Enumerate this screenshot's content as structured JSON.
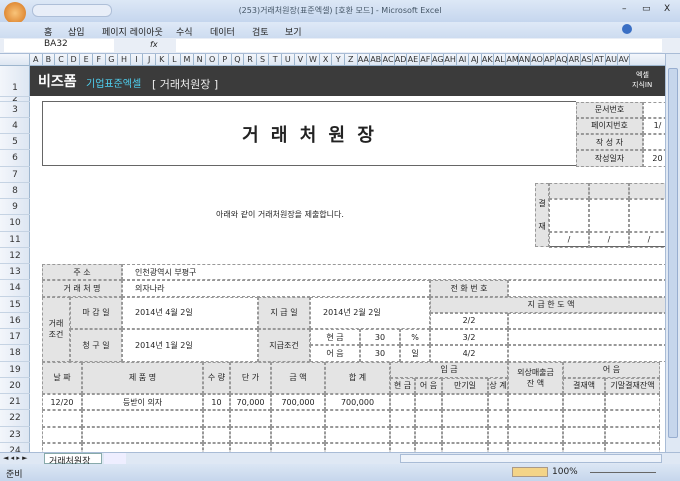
{
  "window": {
    "title": "(253)거래처원장(표준엑셀) [호환 모드] - Microsoft Excel",
    "min": "–",
    "max": "▭",
    "close": "X"
  },
  "ribbon": {
    "tabs": [
      "홈",
      "삽입",
      "페이지 레이아웃",
      "수식",
      "데이터",
      "검토",
      "보기"
    ]
  },
  "formula": {
    "name_box": "BA32",
    "fx": "fx",
    "value": ""
  },
  "columns": [
    "A",
    "B",
    "C",
    "D",
    "E",
    "F",
    "G",
    "H",
    "I",
    "J",
    "K",
    "L",
    "M",
    "N",
    "O",
    "P",
    "Q",
    "R",
    "S",
    "T",
    "U",
    "V",
    "W",
    "X",
    "Y",
    "Z",
    "AA",
    "AB",
    "AC",
    "AD",
    "AE",
    "AF",
    "AG",
    "AH",
    "AI",
    "AJ",
    "AK",
    "AL",
    "AM",
    "AN",
    "AO",
    "AP",
    "AQ",
    "AR",
    "AS",
    "AT",
    "AU",
    "AV"
  ],
  "rows": [
    "1",
    "2",
    "3",
    "4",
    "5",
    "6",
    "7",
    "8",
    "9",
    "10",
    "11",
    "12",
    "13",
    "14",
    "15",
    "16",
    "17",
    "18",
    "19",
    "20",
    "21",
    "22",
    "23",
    "24"
  ],
  "banner": {
    "brand": "비즈폼",
    "sub": "기업표준엑셀",
    "title": "[ 거래처원장 ]",
    "right1": "엑셀",
    "right2": "지식IN"
  },
  "doc": {
    "title": "거 래 처 원 장",
    "info_labels": [
      "문서번호",
      "페이지번호",
      "작 성 자",
      "작성일자"
    ],
    "info_values": [
      "",
      "1/",
      "",
      "20"
    ],
    "notice": "아래와 같이 거래처원장을 제출합니다.",
    "approval": {
      "label1": "결",
      "label2": "재",
      "slash": "/"
    }
  },
  "form": {
    "address_label": "주 소",
    "address": "인천광역시 부평구",
    "client_label": "거 래 처 명",
    "client": "의자나라",
    "phone_label": "전 화 번 호",
    "phone": "",
    "terms_label": "거래\n조건",
    "close_label": "마 감 일",
    "close_date": "2014년 4월 2일",
    "pay_label": "지 급 일",
    "pay_date": "2014년 2월 2일",
    "limit_label": "지 급 한 도 액",
    "bill_label": "청 구 일",
    "bill_date": "2014년 1월 2일",
    "payterm_label": "지급조건",
    "cash": "현 금",
    "cash_val": "30",
    "cash_unit": "%",
    "note": "어 음",
    "note_val": "30",
    "note_unit": "일",
    "limits": [
      "2/2",
      "3/2",
      "4/2"
    ]
  },
  "table": {
    "headers": {
      "date": "날 짜",
      "product": "제   품   명",
      "qty": "수 량",
      "price": "단 가",
      "amount": "금 액",
      "total": "합 계",
      "deposit": "입          금",
      "cash": "현 금",
      "note": "어 음",
      "due": "만기일",
      "offset": "상 계",
      "ar": "외상매출금\n잔      액",
      "bill": "어          음",
      "paid": "결재액",
      "remain": "기말결재잔액"
    },
    "rows": [
      {
        "date": "12/20",
        "product": "등받이 의자",
        "qty": "10",
        "price": "70,000",
        "amount": "700,000",
        "total": "700,000"
      }
    ]
  },
  "sheet_tab": "거래처원장",
  "status": {
    "ready": "준비",
    "zoom": "100%"
  }
}
